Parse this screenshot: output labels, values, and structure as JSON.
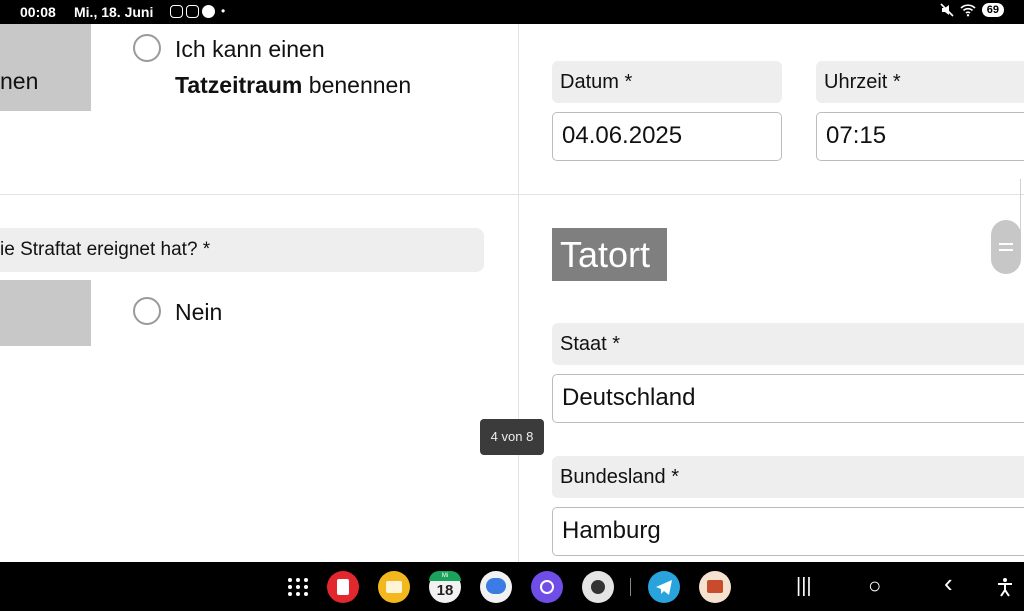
{
  "statusbar": {
    "time": "00:08",
    "date": "Mi., 18. Juni",
    "notification_icons": [
      "instagram-icon",
      "instagram-icon",
      "app-icon"
    ],
    "dot": "•",
    "battery": "69"
  },
  "left": {
    "option_box_text": "nen",
    "option1_line1": "Ich kann einen",
    "option1_bold": "Tatzeitraum",
    "option1_rest": " benennen",
    "question": "ie Straftat ereignet hat? *",
    "option2": "Nein"
  },
  "right": {
    "datum_label": "Datum *",
    "datum_value": "04.06.2025",
    "uhrzeit_label": "Uhrzeit *",
    "uhrzeit_value": "07:15",
    "section_title": "Tatort",
    "staat_label": "Staat *",
    "staat_value": "Deutschland",
    "bundesland_label": "Bundesland *",
    "bundesland_value": "Hamburg"
  },
  "page_indicator": "4 von 8",
  "taskbar": {
    "apps": [
      "apps-grid-icon",
      "notes-app-icon",
      "files-app-icon",
      "calendar-app-icon",
      "messages-app-icon",
      "internet-app-icon",
      "camera-app-icon",
      "telegram-app-icon",
      "slides-app-icon"
    ],
    "calendar_day": "18",
    "calendar_month": "Mi",
    "nav_recent": "|||",
    "nav_home": "○",
    "nav_back": "‹",
    "colors": {
      "notes": "#e2282c",
      "files": "#f3b81d",
      "messages": "#3b7ce4",
      "internet": "#6f4ee8",
      "camera": "#e4e4e4",
      "telegram": "#29a3dd",
      "slides": "#f4e1cf"
    }
  }
}
